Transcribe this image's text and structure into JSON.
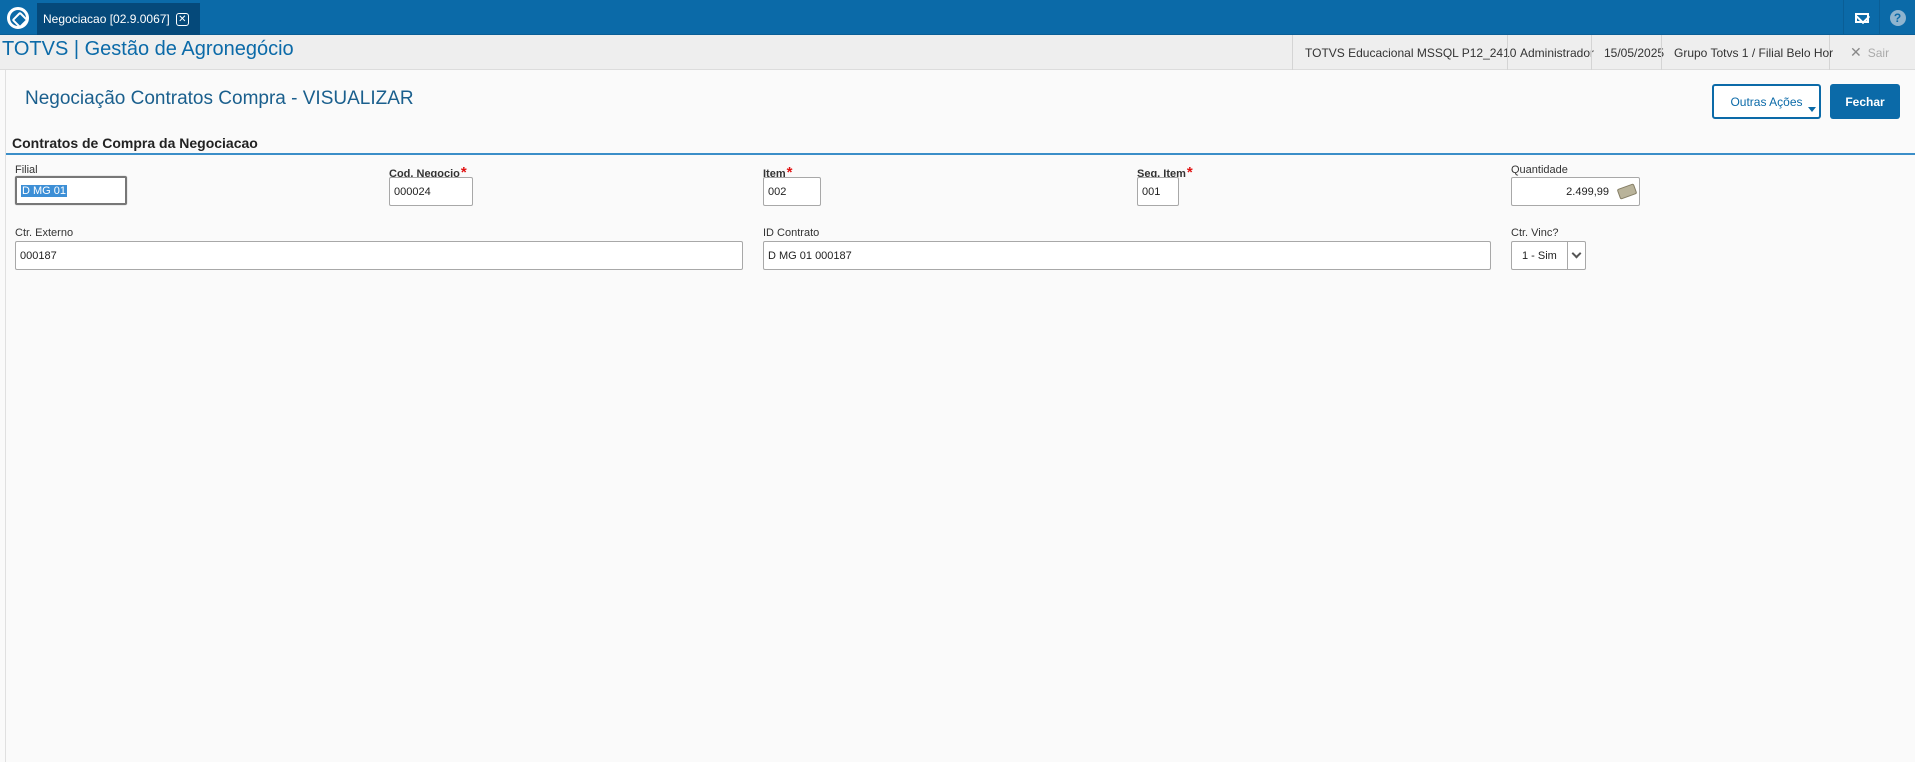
{
  "topbar": {
    "tab_label": "Negociacao [02.9.0067]",
    "close_glyph": "✕"
  },
  "header": {
    "app_title": "TOTVS | Gestão de Agronegócio",
    "environment": "TOTVS Educacional MSSQL P12_2410",
    "user": "Administrador",
    "date": "15/05/2025",
    "branch": "Grupo Totvs 1 / Filial Belo Hor",
    "exit_label": "Sair"
  },
  "page": {
    "title": "Negociação Contratos Compra - VISUALIZAR",
    "other_actions_label": "Outras Ações",
    "close_label": "Fechar"
  },
  "section": {
    "title": "Contratos de Compra da Negociacao"
  },
  "fields": {
    "filial": {
      "label": "Filial",
      "value": "D MG 01"
    },
    "cod_negocio": {
      "label": "Cod. Negocio",
      "value": "000024",
      "required_mark": "*"
    },
    "item": {
      "label": "Item",
      "value": "002",
      "required_mark": "*"
    },
    "seq_item": {
      "label": "Seq. Item",
      "value": "001",
      "required_mark": "*"
    },
    "quantidade": {
      "label": "Quantidade",
      "value": "2.499,99"
    },
    "ctr_externo": {
      "label": "Ctr. Externo",
      "value": "000187"
    },
    "id_contrato": {
      "label": "ID Contrato",
      "value": "D MG 01 000187"
    },
    "ctr_vinc": {
      "label": "Ctr. Vinc?",
      "value": "1 - Sim"
    }
  },
  "icons": {
    "logo": "totvs-logo-icon",
    "mail": "mail-icon",
    "help": "help-icon",
    "close": "close-icon",
    "money": "money-icon",
    "dropdown": "chevron-down-icon"
  },
  "colors": {
    "brand": "#0b6aa8",
    "required": "#e01010",
    "section_line": "#3b8ec8"
  }
}
